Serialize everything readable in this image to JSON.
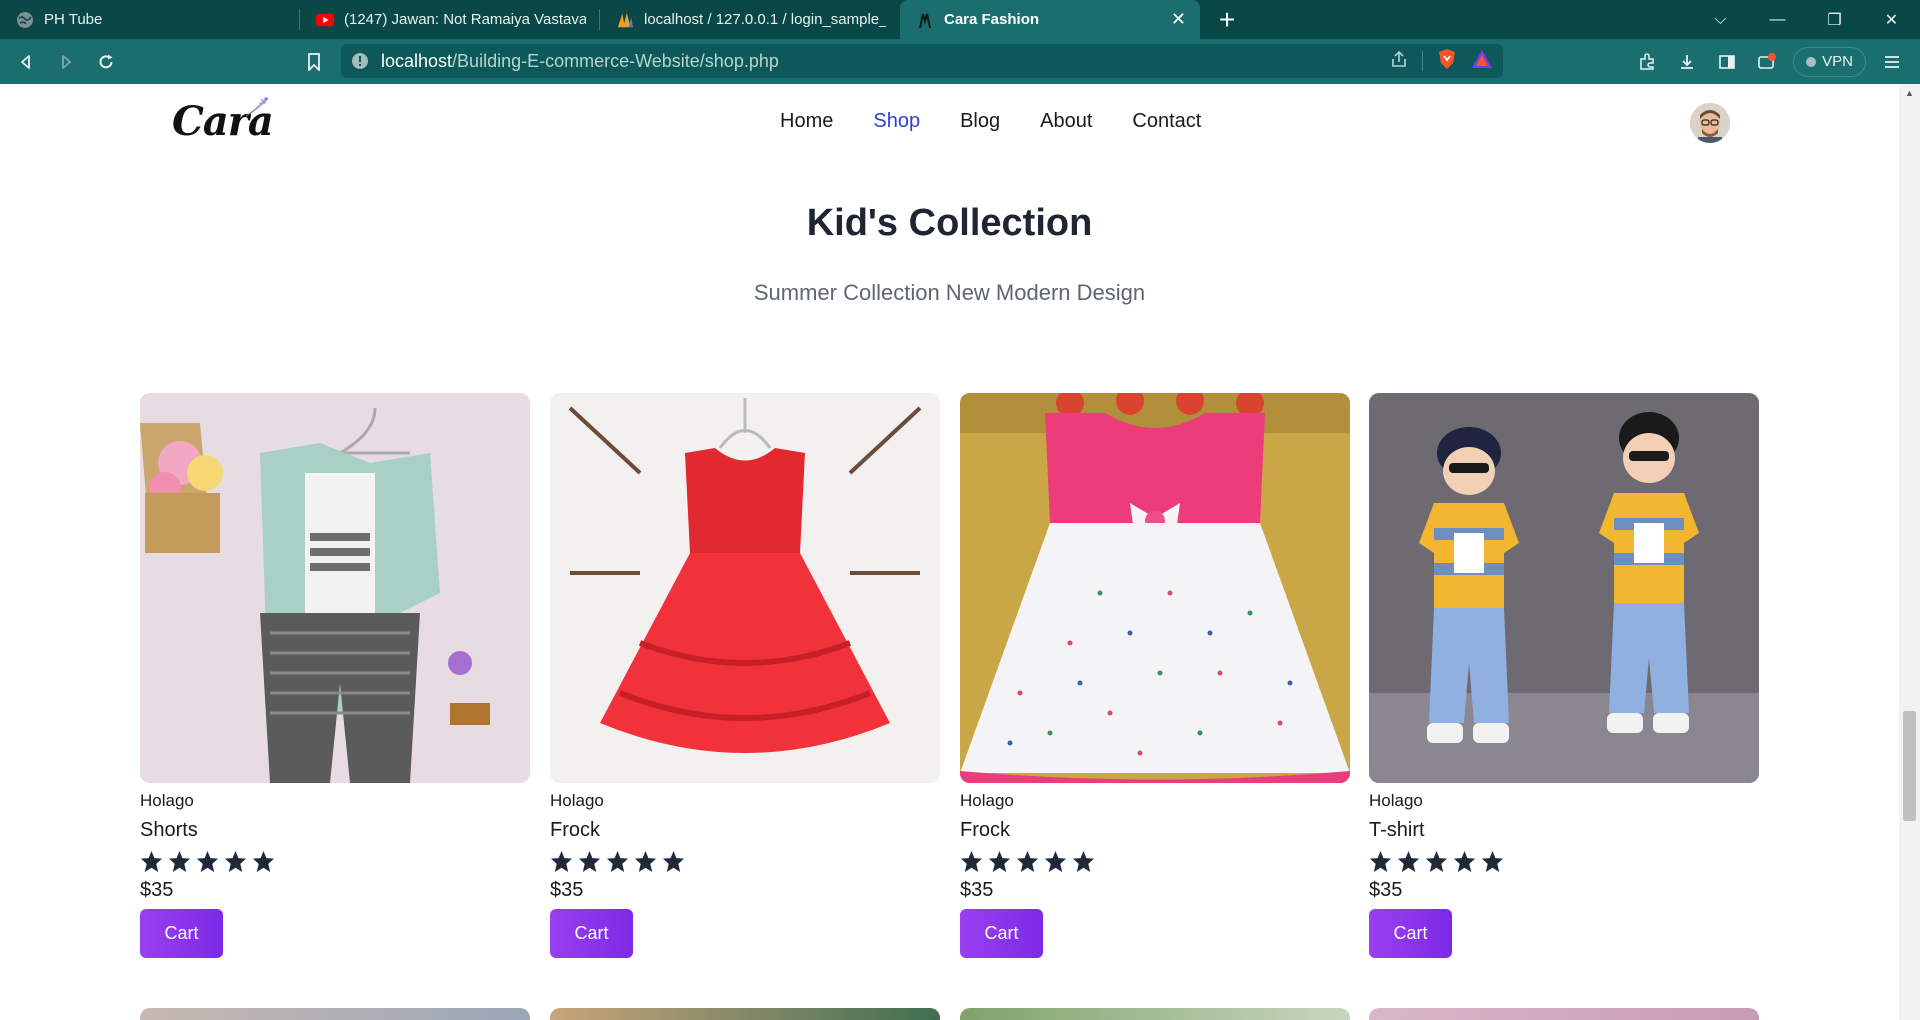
{
  "browser": {
    "tabs": [
      {
        "title": "PH Tube",
        "icon": "globe-icon"
      },
      {
        "title": "(1247) Jawan: Not Ramaiya Vastavaiya",
        "icon": "youtube-icon"
      },
      {
        "title": "localhost / 127.0.0.1 / login_sample_db",
        "icon": "phpmyadmin-icon"
      },
      {
        "title": "Cara Fashion",
        "icon": "site-icon",
        "active": true
      }
    ],
    "url_host": "localhost",
    "url_path": "/Building-E-commerce-Website/shop.php",
    "vpn_label": "VPN"
  },
  "site": {
    "logo": "Cara",
    "nav": [
      "Home",
      "Shop",
      "Blog",
      "About",
      "Contact"
    ],
    "active_nav": "Shop"
  },
  "section": {
    "title": "Kid's Collection",
    "subtitle": "Summer Collection New Modern Design"
  },
  "products": [
    {
      "brand": "Holago",
      "name": "Shorts",
      "rating": 5,
      "price": "$35",
      "cart_label": "Cart"
    },
    {
      "brand": "Holago",
      "name": "Frock",
      "rating": 5,
      "price": "$35",
      "cart_label": "Cart"
    },
    {
      "brand": "Holago",
      "name": "Frock",
      "rating": 5,
      "price": "$35",
      "cart_label": "Cart"
    },
    {
      "brand": "Holago",
      "name": "T-shirt",
      "rating": 5,
      "price": "$35",
      "cart_label": "Cart"
    }
  ],
  "colors": {
    "chrome_dark": "#0a4747",
    "chrome": "#1b6e6e",
    "nav_active": "#2f3fce",
    "cart_button": "#8a35eb"
  }
}
